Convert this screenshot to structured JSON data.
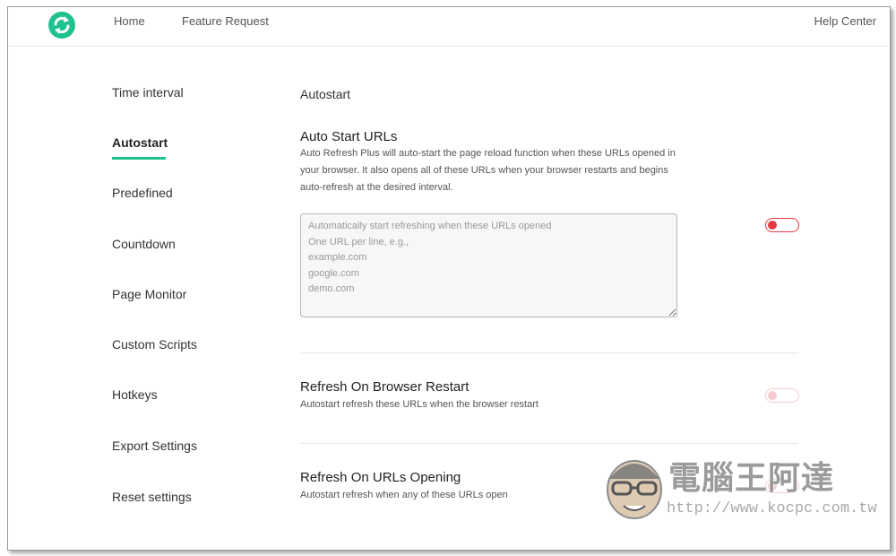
{
  "header": {
    "nav": [
      "Home",
      "Feature Request"
    ],
    "help_label": "Help Center"
  },
  "sidebar": {
    "items": [
      {
        "label": "Time interval"
      },
      {
        "label": "Autostart"
      },
      {
        "label": "Predefined"
      },
      {
        "label": "Countdown"
      },
      {
        "label": "Page Monitor"
      },
      {
        "label": "Custom Scripts"
      },
      {
        "label": "Hotkeys"
      },
      {
        "label": "Export Settings"
      },
      {
        "label": "Reset settings"
      }
    ],
    "active": "Autostart"
  },
  "main": {
    "section_title": "Autostart",
    "auto_start": {
      "title": "Auto Start URLs",
      "description": "Auto Refresh Plus will auto-start the page reload function when these URLs opened in your browser. It also opens all of these URLs when your browser restarts and begins auto-refresh at the desired interval.",
      "textarea_value": "",
      "textarea_placeholder": "Automatically start refreshing when these URLs opened\nOne URL per line, e.g.,\nexample.com\ngoogle.com\ndemo.com",
      "enabled": false
    },
    "refresh_restart": {
      "title": "Refresh On Browser Restart",
      "description": "Autostart refresh these URLs when the browser restart",
      "enabled": false
    },
    "refresh_opening": {
      "title": "Refresh On URLs Opening",
      "description": "Autostart refresh when any of these URLs open",
      "enabled": false
    }
  },
  "watermark": {
    "title": "電腦王阿達",
    "url": "http://www.kocpc.com.tw"
  },
  "colors": {
    "accent": "#1fc28e",
    "toggle_off": "#e5393f"
  }
}
